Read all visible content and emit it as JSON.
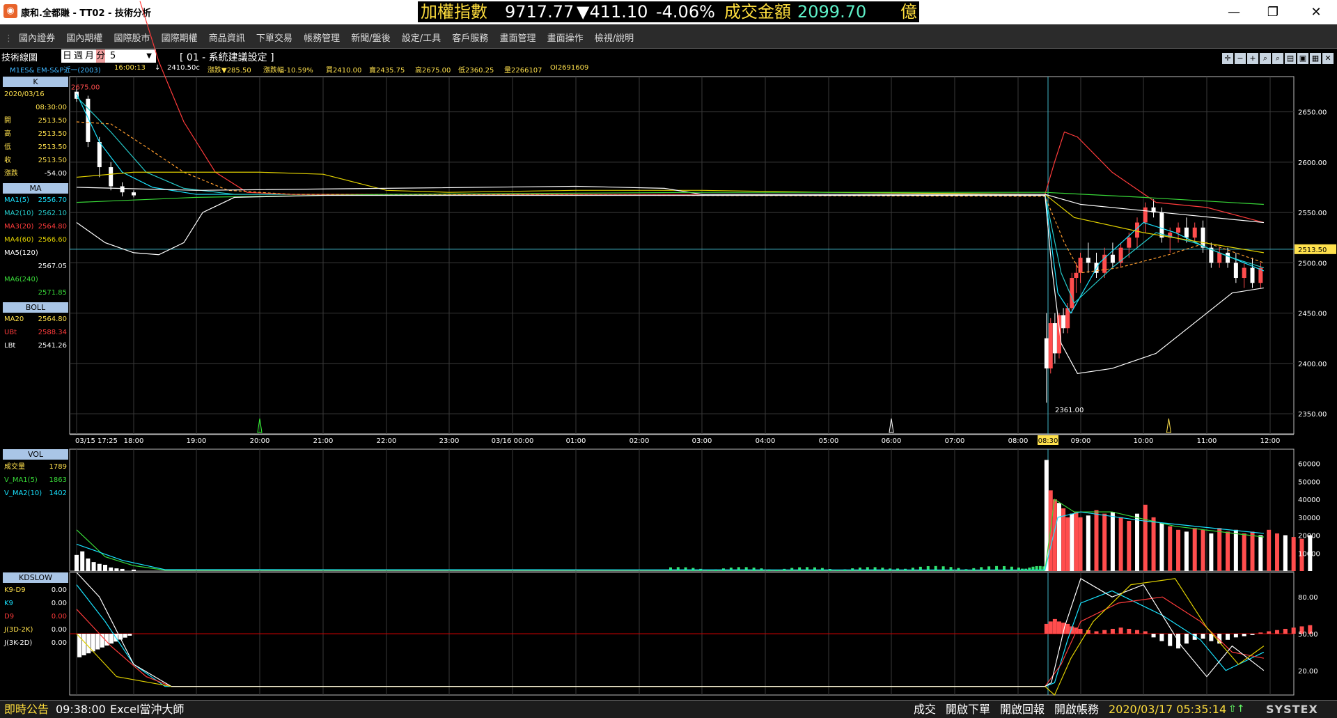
{
  "window": {
    "title": "康和.全都賺 - TT02 - 技術分析",
    "min": "—",
    "max": "❐",
    "close": "✕"
  },
  "ticker": {
    "label1": "加權指數",
    "value": "9717.77",
    "change": "▼411.10",
    "pct": "-4.06%",
    "label2": "成交金額",
    "amount": "2099.70",
    "unit": "億"
  },
  "menu": [
    "國內證券",
    "國內期權",
    "國際股市",
    "國際期權",
    "商品資訊",
    "下單交易",
    "帳務管理",
    "新聞/盤後",
    "設定/工具",
    "客戶服務",
    "畫面管理",
    "畫面操作",
    "檢視/說明"
  ],
  "tabbar": {
    "title": "技術線圖",
    "periods": [
      "日",
      "週",
      "月",
      "分"
    ],
    "active_period": "分",
    "interval": "5",
    "setting": "[ 01 - 系統建議設定 ]"
  },
  "quote": {
    "symbol": "M1ES&  EM-S&P近一(2003)",
    "time": "16:00:13",
    "arrow": "↓",
    "last": "2410.50c",
    "change": "漲跌▼285.50",
    "pct": "漲跌幅-10.59%",
    "buy": "買2410.00",
    "sell": "賣2435.75",
    "high": "高2675.00",
    "low": "低2360.25",
    "vol": "量2266107",
    "oi": "OI2691609"
  },
  "legend_k": {
    "header": "K",
    "date": "2020/03/16",
    "time": "08:30:00",
    "rows": [
      {
        "k": "開",
        "v": "2513.50"
      },
      {
        "k": "高",
        "v": "2513.50"
      },
      {
        "k": "低",
        "v": "2513.50"
      },
      {
        "k": "收",
        "v": "2513.50"
      },
      {
        "k": "漲跌",
        "v": "-54.00"
      }
    ]
  },
  "legend_ma": {
    "header": "MA",
    "rows": [
      {
        "k": "MA1(5)",
        "v": "2556.70"
      },
      {
        "k": "MA2(10)",
        "v": "2562.10"
      },
      {
        "k": "MA3(20)",
        "v": "2564.80"
      },
      {
        "k": "MA4(60)",
        "v": "2566.60"
      },
      {
        "k": "MA5(120)",
        "v": ""
      },
      {
        "k": "",
        "v": "2567.05"
      },
      {
        "k": "MA6(240)",
        "v": ""
      },
      {
        "k": "",
        "v": "2571.85"
      }
    ]
  },
  "legend_boll": {
    "header": "BOLL",
    "rows": [
      {
        "k": "MA20",
        "v": "2564.80"
      },
      {
        "k": "UBt",
        "v": "2588.34"
      },
      {
        "k": "LBt",
        "v": "2541.26"
      }
    ]
  },
  "legend_vol": {
    "header": "VOL",
    "rows": [
      {
        "k": "成交量",
        "v": "1789"
      },
      {
        "k": "V_MA1(5)",
        "v": "1863"
      },
      {
        "k": "V_MA2(10)",
        "v": "1402"
      }
    ]
  },
  "legend_kd": {
    "header": "KDSLOW",
    "rows": [
      {
        "k": "K9-D9",
        "v": "0.00"
      },
      {
        "k": "K9",
        "v": "0.00"
      },
      {
        "k": "D9",
        "v": "0.00"
      },
      {
        "k": "J(3D-2K)",
        "v": "0.00"
      },
      {
        "k": "J(3K-2D)",
        "v": "0.00"
      }
    ]
  },
  "colors": {
    "ma1": "#19e3ff",
    "ma2": "#25c9c9",
    "ma3": "#ff3b3b",
    "ma4": "#e0d000",
    "ma5": "#38d838",
    "ma6": "#ffffff",
    "up": "#ff4d4d",
    "down": "#ffffff",
    "volume_low": "#32e36e",
    "grid": "#3a3a3a",
    "cursor": "#3fb6c8"
  },
  "chart_data": [
    {
      "type": "line",
      "name": "K",
      "x_ticks": [
        "03/15 17:25",
        "18:00",
        "19:00",
        "20:00",
        "21:00",
        "22:00",
        "23:00",
        "03/16 00:00",
        "01:00",
        "02:00",
        "03:00",
        "04:00",
        "05:00",
        "06:00",
        "07:00",
        "08:00",
        "08:30",
        "09:00",
        "10:00",
        "11:00",
        "12:00"
      ],
      "y_ticks": [
        "2650.00",
        "2600.00",
        "2550.00",
        "2500.00",
        "2450.00",
        "2400.00",
        "2350.00"
      ],
      "ylim": [
        2330,
        2685
      ],
      "last_price_label": "2513.50",
      "high_label": "2675.00",
      "low_label": "2361.00",
      "candles": [
        {
          "t": 0.0,
          "o": 2670,
          "h": 2675,
          "l": 2660,
          "c": 2663
        },
        {
          "t": 0.2,
          "o": 2663,
          "h": 2666,
          "l": 2615,
          "c": 2620
        },
        {
          "t": 0.4,
          "o": 2620,
          "h": 2625,
          "l": 2585,
          "c": 2595
        },
        {
          "t": 0.6,
          "o": 2595,
          "h": 2600,
          "l": 2572,
          "c": 2576
        },
        {
          "t": 0.8,
          "o": 2576,
          "h": 2580,
          "l": 2566,
          "c": 2570
        },
        {
          "t": 1.0,
          "o": 2570,
          "h": 2572,
          "l": 2565,
          "c": 2567
        },
        {
          "t": 15.95,
          "o": 2425,
          "h": 2450,
          "l": 2361,
          "c": 2395
        },
        {
          "t": 16.08,
          "o": 2395,
          "h": 2445,
          "l": 2390,
          "c": 2440
        },
        {
          "t": 16.21,
          "o": 2440,
          "h": 2450,
          "l": 2400,
          "c": 2410
        },
        {
          "t": 16.34,
          "o": 2410,
          "h": 2450,
          "l": 2405,
          "c": 2448
        },
        {
          "t": 16.47,
          "o": 2448,
          "h": 2455,
          "l": 2430,
          "c": 2435
        },
        {
          "t": 16.6,
          "o": 2435,
          "h": 2460,
          "l": 2430,
          "c": 2455
        },
        {
          "t": 16.73,
          "o": 2455,
          "h": 2490,
          "l": 2450,
          "c": 2485
        },
        {
          "t": 16.86,
          "o": 2485,
          "h": 2500,
          "l": 2470,
          "c": 2490
        },
        {
          "t": 16.99,
          "o": 2490,
          "h": 2510,
          "l": 2480,
          "c": 2505
        },
        {
          "t": 17.12,
          "o": 2505,
          "h": 2520,
          "l": 2490,
          "c": 2500
        },
        {
          "t": 17.25,
          "o": 2500,
          "h": 2510,
          "l": 2485,
          "c": 2490
        },
        {
          "t": 17.38,
          "o": 2490,
          "h": 2515,
          "l": 2485,
          "c": 2508
        },
        {
          "t": 17.51,
          "o": 2508,
          "h": 2520,
          "l": 2495,
          "c": 2500
        },
        {
          "t": 17.64,
          "o": 2500,
          "h": 2520,
          "l": 2495,
          "c": 2515
        },
        {
          "t": 17.77,
          "o": 2515,
          "h": 2530,
          "l": 2505,
          "c": 2525
        },
        {
          "t": 17.9,
          "o": 2525,
          "h": 2545,
          "l": 2515,
          "c": 2540
        },
        {
          "t": 18.03,
          "o": 2540,
          "h": 2560,
          "l": 2530,
          "c": 2555
        },
        {
          "t": 18.16,
          "o": 2555,
          "h": 2563,
          "l": 2545,
          "c": 2550
        },
        {
          "t": 18.29,
          "o": 2550,
          "h": 2555,
          "l": 2520,
          "c": 2525
        },
        {
          "t": 18.42,
          "o": 2525,
          "h": 2535,
          "l": 2510,
          "c": 2530
        },
        {
          "t": 18.55,
          "o": 2530,
          "h": 2540,
          "l": 2520,
          "c": 2535
        },
        {
          "t": 18.68,
          "o": 2535,
          "h": 2545,
          "l": 2520,
          "c": 2525
        },
        {
          "t": 18.81,
          "o": 2525,
          "h": 2540,
          "l": 2520,
          "c": 2535
        },
        {
          "t": 18.94,
          "o": 2535,
          "h": 2542,
          "l": 2510,
          "c": 2515
        },
        {
          "t": 19.07,
          "o": 2515,
          "h": 2520,
          "l": 2495,
          "c": 2500
        },
        {
          "t": 19.2,
          "o": 2500,
          "h": 2515,
          "l": 2495,
          "c": 2510
        },
        {
          "t": 19.33,
          "o": 2510,
          "h": 2515,
          "l": 2495,
          "c": 2500
        },
        {
          "t": 19.46,
          "o": 2500,
          "h": 2510,
          "l": 2480,
          "c": 2485
        },
        {
          "t": 19.59,
          "o": 2485,
          "h": 2500,
          "l": 2475,
          "c": 2495
        },
        {
          "t": 19.72,
          "o": 2495,
          "h": 2505,
          "l": 2475,
          "c": 2480
        },
        {
          "t": 19.85,
          "o": 2480,
          "h": 2500,
          "l": 2475,
          "c": 2495
        }
      ]
    },
    {
      "type": "bar",
      "name": "VOL",
      "y_ticks": [
        "60000",
        "50000",
        "40000",
        "30000",
        "20000",
        "10000"
      ],
      "ylim": [
        0,
        68000
      ]
    },
    {
      "type": "line",
      "name": "KDSLOW",
      "y_ticks": [
        "80.00",
        "50.00",
        "20.00"
      ],
      "ylim": [
        0,
        100
      ]
    }
  ],
  "status": {
    "left": "即時公告",
    "time": "09:38:00",
    "news": "Excel當沖大師",
    "items": [
      "成交",
      "開啟下單",
      "開啟回報",
      "開啟帳務"
    ],
    "datetime": "2020/03/17 05:35:14",
    "brand": "SYSTEX"
  }
}
